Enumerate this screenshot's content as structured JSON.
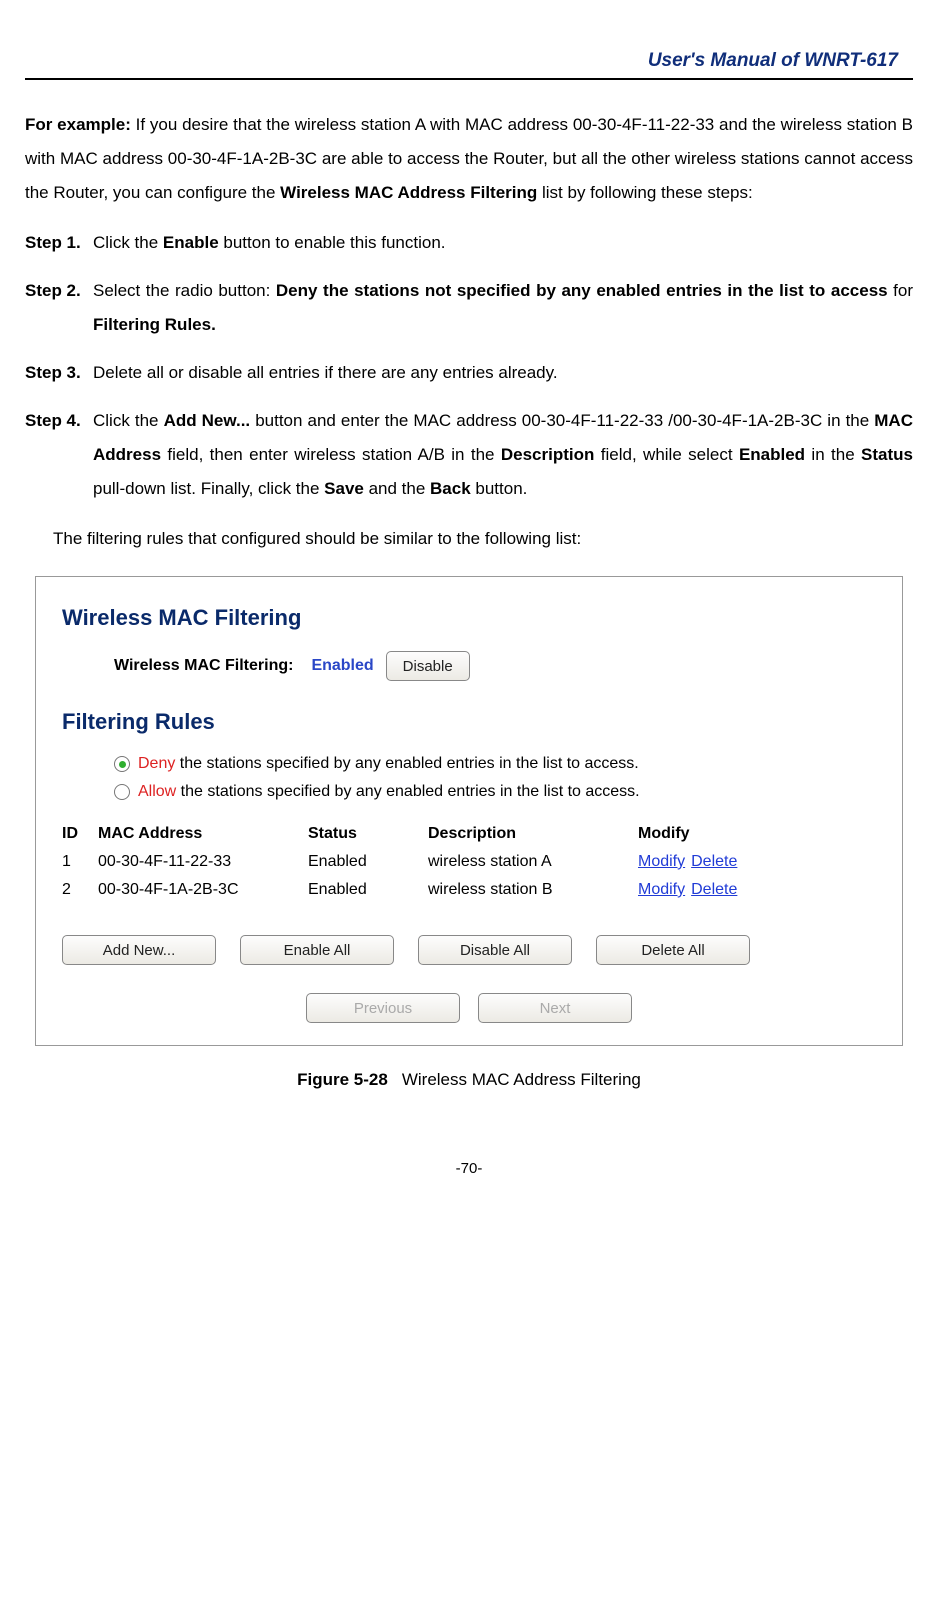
{
  "header": {
    "title": "User's Manual of WNRT-617"
  },
  "intro": {
    "lead": "For example:",
    "text_part1": " If you desire that the wireless station A with MAC address 00-30-4F-11-22-33 and the wireless station B with MAC address 00-30-4F-1A-2B-3C are able to access the Router, but all the other wireless stations cannot access the Router, you can configure the ",
    "bold1": "Wireless MAC Address Filtering",
    "text_part2": " list by following these steps:"
  },
  "steps": {
    "s1": {
      "label": "Step 1.",
      "pre": "Click the ",
      "b1": "Enable",
      "post": " button to enable this function."
    },
    "s2": {
      "label": "Step 2.",
      "pre": "Select the radio button: ",
      "b1": "Deny the stations not specified by any enabled entries in the list to access",
      "mid": " for ",
      "b2": "Filtering Rules."
    },
    "s3": {
      "label": "Step 3.",
      "text": "Delete all or disable all entries if there are any entries already."
    },
    "s4": {
      "label": "Step 4.",
      "t1": "Click the ",
      "b1": "Add New...",
      "t2": " button and enter the MAC address 00-30-4F-11-22-33 /00-30-4F-1A-2B-3C in the ",
      "b2": "MAC Address",
      "t3": " field, then enter wireless station A/B in the ",
      "b3": "Description",
      "t4": " field, while select ",
      "b4": "Enabled",
      "t5": " in the ",
      "b5": "Status",
      "t6": " pull-down list. Finally, click the ",
      "b6": "Save",
      "t7": " and the ",
      "b7": "Back",
      "t8": " button."
    }
  },
  "after_steps": "The filtering rules that configured should be similar to the following list:",
  "panel": {
    "title1": "Wireless MAC Filtering",
    "status_label": "Wireless MAC Filtering:",
    "enabled": "Enabled",
    "disable_btn": "Disable",
    "title2": "Filtering Rules",
    "rule_deny_kw": "Deny",
    "rule_deny_rest": " the stations specified by any enabled entries in the list to access.",
    "rule_allow_kw": "Allow",
    "rule_allow_rest": " the stations specified by any enabled entries in the list to access.",
    "headers": {
      "id": "ID",
      "mac": "MAC Address",
      "status": "Status",
      "desc": "Description",
      "modify": "Modify"
    },
    "rows": [
      {
        "id": "1",
        "mac": "00-30-4F-11-22-33",
        "status": "Enabled",
        "desc": "wireless station A",
        "modify": "Modify",
        "delete": "Delete"
      },
      {
        "id": "2",
        "mac": "00-30-4F-1A-2B-3C",
        "status": "Enabled",
        "desc": "wireless station B",
        "modify": "Modify",
        "delete": "Delete"
      }
    ],
    "buttons": {
      "add": "Add New...",
      "enable_all": "Enable All",
      "disable_all": "Disable All",
      "delete_all": "Delete All"
    },
    "nav": {
      "prev": "Previous",
      "next": "Next"
    }
  },
  "caption": {
    "label": "Figure 5-28",
    "text": "Wireless MAC Address Filtering"
  },
  "page": "-70-"
}
